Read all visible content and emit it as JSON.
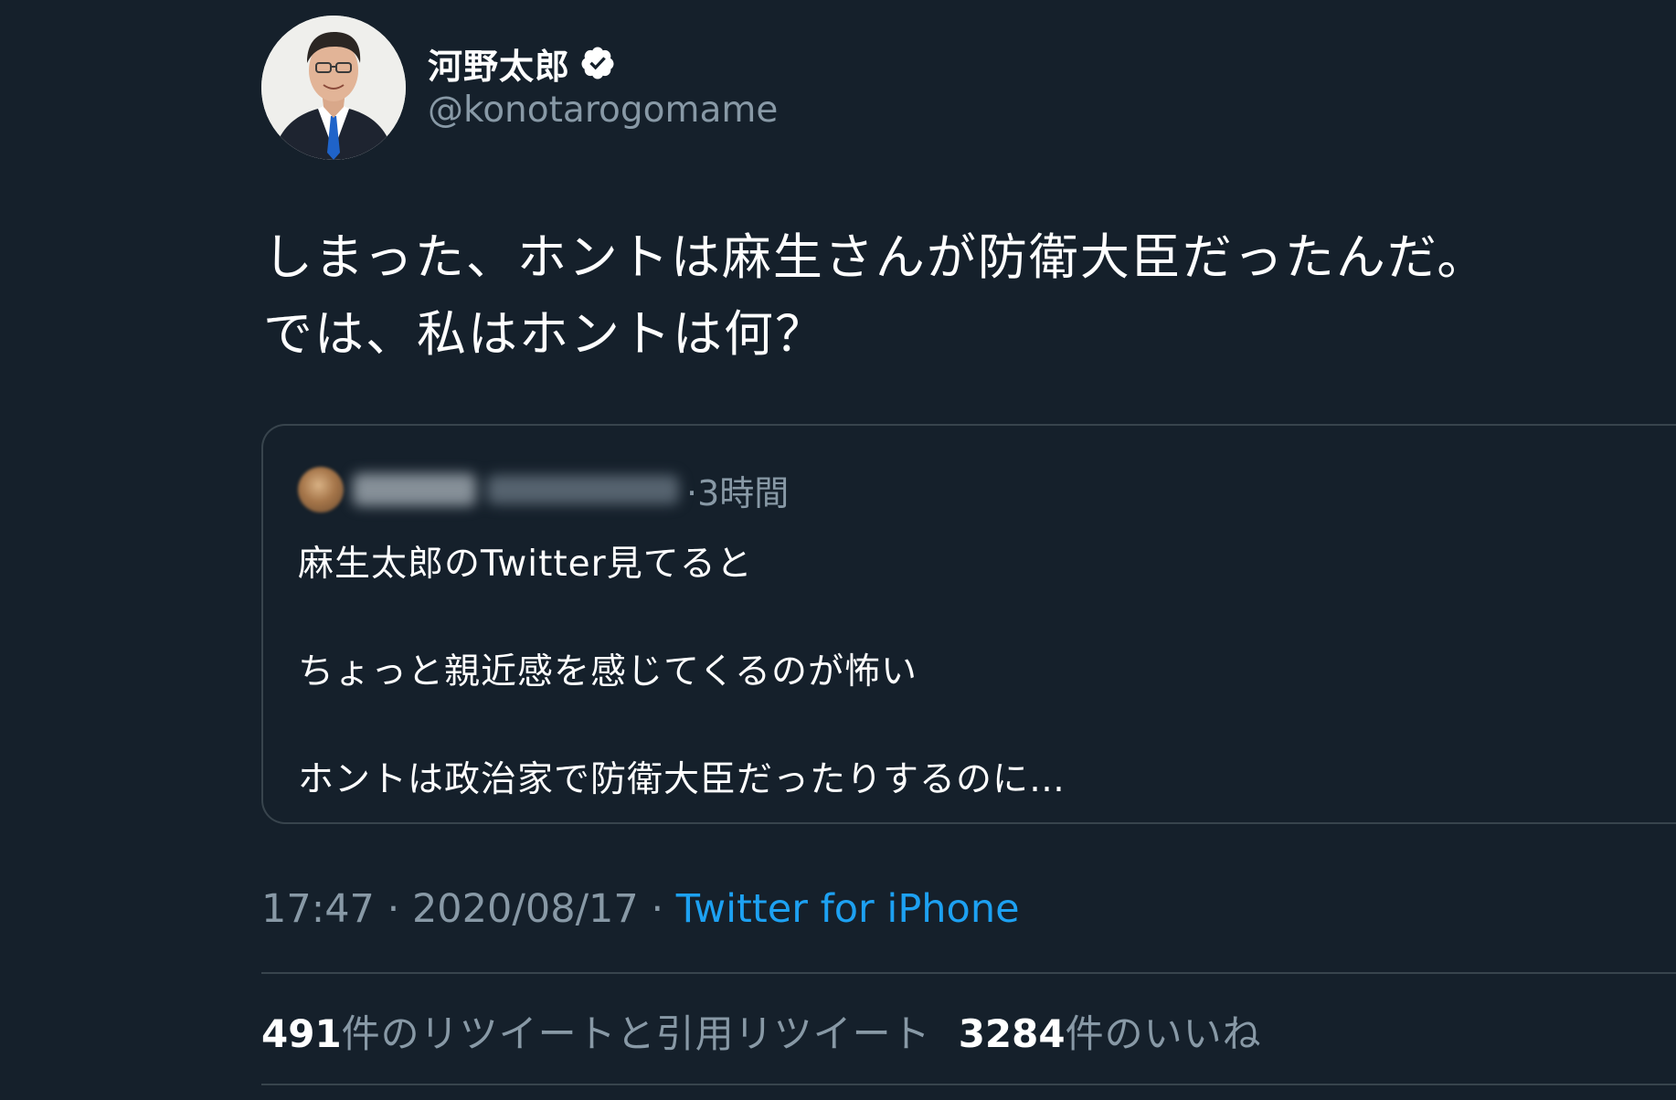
{
  "author": {
    "display_name": "河野太郎",
    "handle": "@konotarogomame",
    "verified": true,
    "avatar_icon": "profile-photo"
  },
  "tweet": {
    "lines": [
      "しまった、ホントは麻生さんが防衛大臣だったんだ。",
      "では、私はホントは何？"
    ]
  },
  "quoted_tweet": {
    "time": "·3時間",
    "lines": [
      "麻生太郎のTwitter見てると",
      "ちょっと親近感を感じてくるのが怖い",
      "ホントは政治家で防衛大臣だったりするのに…"
    ]
  },
  "meta": {
    "time": "17:47",
    "separator": " · ",
    "date": "2020/08/17",
    "source": "Twitter for iPhone"
  },
  "stats": {
    "retweets_count": "491",
    "retweets_label": "件のリツイートと引用リツイート",
    "likes_count": "3284",
    "likes_label": "件のいいね"
  },
  "colors": {
    "background": "#15202b",
    "text_primary": "#ffffff",
    "text_secondary": "#8899a6",
    "link": "#1da1f2",
    "border": "#38444d"
  }
}
